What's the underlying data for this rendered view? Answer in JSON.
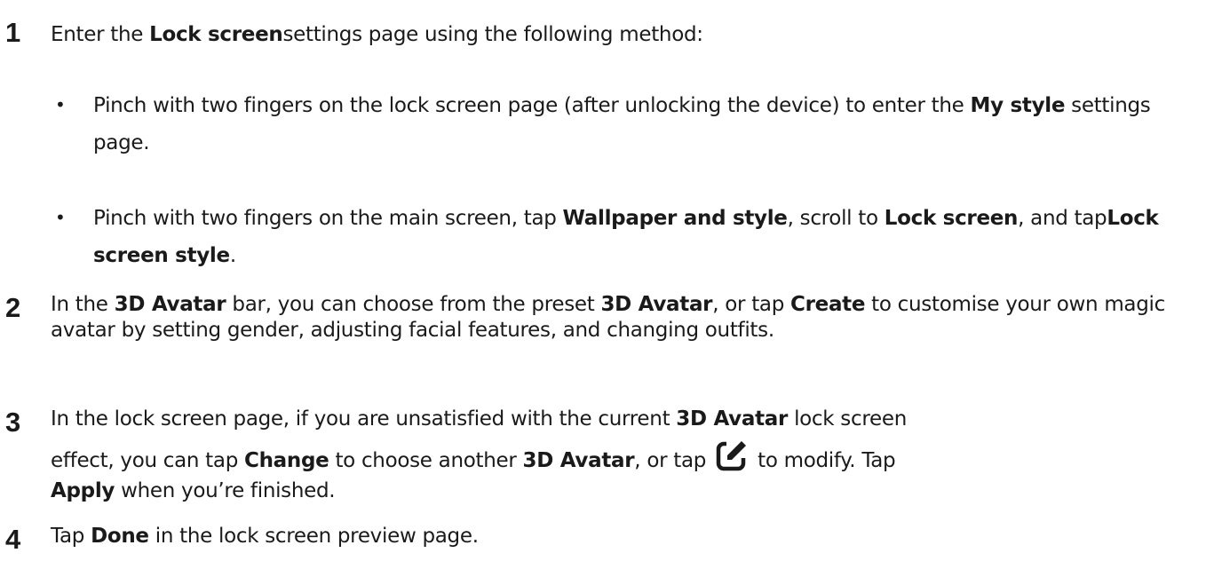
{
  "steps": [
    {
      "number": "1",
      "parts": [
        "Enter the ",
        "Lock screen",
        "settings page using the following method:"
      ],
      "bullets": [
        {
          "parts": [
            "Pinch with two fingers on the lock screen page (after unlocking the device) to enter the ",
            "My style",
            " settings page."
          ]
        },
        {
          "parts": [
            "Pinch with two fingers on the main screen, tap ",
            "Wallpaper and style",
            ", scroll to ",
            "Lock screen",
            ", and tap",
            "Lock screen style",
            "."
          ]
        }
      ]
    },
    {
      "number": "2",
      "parts": [
        "In the ",
        "3D Avatar",
        " bar, you can choose from the preset ",
        "3D Avatar",
        ", or tap ",
        "Create",
        " to customise your own magic avatar by setting gender, adjusting facial features, and changing outfits."
      ]
    },
    {
      "number": "3",
      "line1": [
        "In the lock screen page, if you are unsatisfied with the current ",
        "3D Avatar",
        " lock screen"
      ],
      "line2": [
        "effect, you can tap ",
        "Change",
        " to choose another ",
        "3D Avatar",
        ", or tap ",
        " to modify. Tap"
      ],
      "line3": [
        "Apply",
        " when you’re finished."
      ],
      "icon": "edit-icon"
    },
    {
      "number": "4",
      "parts": [
        "Tap ",
        "Done",
        " in the lock screen preview page."
      ]
    }
  ]
}
